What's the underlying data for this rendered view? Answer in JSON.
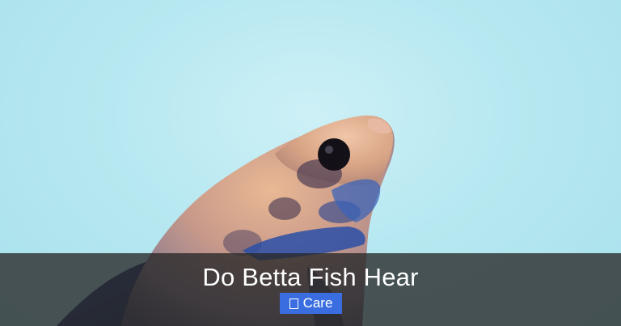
{
  "hero": {
    "image_subject": "betta fish",
    "background_color": "#b7e8f1"
  },
  "post": {
    "title": "Do Betta Fish Hear",
    "category": {
      "label": "Care",
      "icon": "category-icon",
      "color": "#3a6ee0"
    }
  },
  "overlay": {
    "color": "#282828"
  }
}
